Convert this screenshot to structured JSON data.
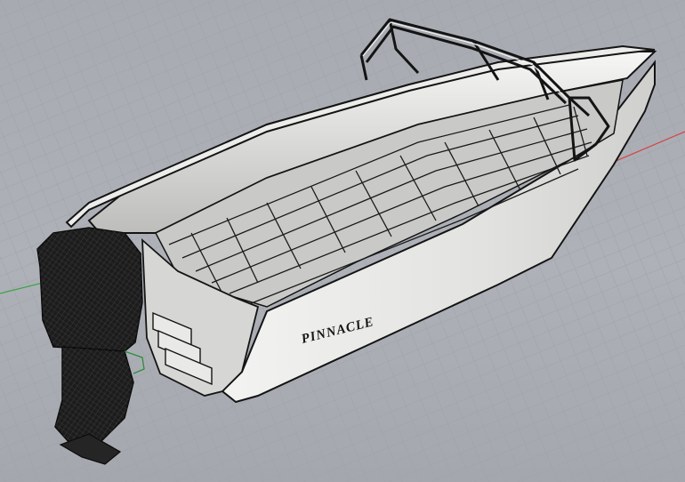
{
  "viewport": {
    "background_color": "#aaaeb4",
    "grid_color": "#9ea2a8",
    "axis_x_color": "#d24a4a",
    "axis_y_color": "#3fa34a"
  },
  "model": {
    "hull_name": "PINNACLE",
    "hull_color": "#e4e4e2",
    "interior_color": "#cfcfcd",
    "outline_color": "#141414",
    "motor_color": "#1c1c1c"
  }
}
